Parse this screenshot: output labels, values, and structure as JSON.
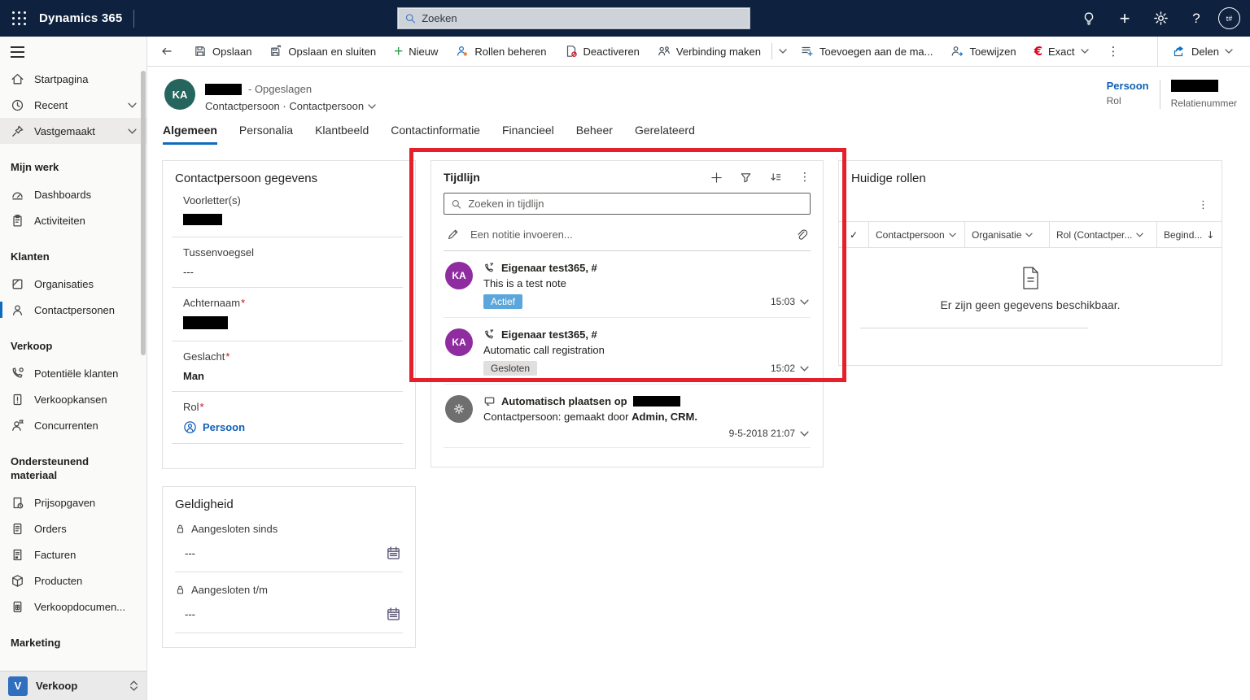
{
  "topnav": {
    "app_title": "Dynamics 365",
    "search_placeholder": "Zoeken",
    "account_initials": "t#"
  },
  "command_bar": {
    "items": [
      {
        "label": "Opslaan",
        "icon": "save-icon"
      },
      {
        "label": "Opslaan en sluiten",
        "icon": "save-close-icon"
      },
      {
        "label": "Nieuw",
        "icon": "plus-icon"
      },
      {
        "label": "Rollen beheren",
        "icon": "manage-roles-icon"
      },
      {
        "label": "Deactiveren",
        "icon": "deactivate-icon"
      },
      {
        "label": "Verbinding maken",
        "icon": "connect-icon"
      },
      {
        "label": "Toevoegen aan de ma...",
        "icon": "add-to-list-icon"
      },
      {
        "label": "Toewijzen",
        "icon": "assign-icon"
      },
      {
        "label": "Exact",
        "icon": "exact-logo"
      }
    ],
    "share_label": "Delen"
  },
  "sidebar": {
    "top_items": [
      {
        "label": "Startpagina",
        "icon": "home-icon"
      },
      {
        "label": "Recent",
        "icon": "clock-icon"
      },
      {
        "label": "Vastgemaakt",
        "icon": "pin-icon"
      }
    ],
    "sections": [
      {
        "header": "Mijn werk",
        "items": [
          {
            "label": "Dashboards"
          },
          {
            "label": "Activiteiten"
          }
        ]
      },
      {
        "header": "Klanten",
        "items": [
          {
            "label": "Organisaties"
          },
          {
            "label": "Contactpersonen"
          }
        ]
      },
      {
        "header": "Verkoop",
        "items": [
          {
            "label": "Potentiële klanten"
          },
          {
            "label": "Verkoopkansen"
          },
          {
            "label": "Concurrenten"
          }
        ]
      },
      {
        "header": "Ondersteunend materiaal",
        "items": [
          {
            "label": "Prijsopgaven"
          },
          {
            "label": "Orders"
          },
          {
            "label": "Facturen"
          },
          {
            "label": "Producten"
          },
          {
            "label": "Verkoopdocumen..."
          }
        ]
      },
      {
        "header": "Marketing",
        "items": []
      }
    ],
    "area_switcher": {
      "initial": "V",
      "label": "Verkoop"
    }
  },
  "record": {
    "avatar_initials": "KA",
    "saved_suffix": "- Opgeslagen",
    "subtitle": "Contactpersoon · Contactpersoon",
    "role_value": "Persoon",
    "role_label": "Rol",
    "relation_label": "Relatienummer"
  },
  "tabs": [
    {
      "label": "Algemeen",
      "active": true
    },
    {
      "label": "Personalia"
    },
    {
      "label": "Klantbeeld"
    },
    {
      "label": "Contactinformatie"
    },
    {
      "label": "Financieel"
    },
    {
      "label": "Beheer"
    },
    {
      "label": "Gerelateerd"
    }
  ],
  "contact_details": {
    "title": "Contactpersoon gegevens",
    "fields": [
      {
        "label": "Voorletter(s)",
        "redacted": true
      },
      {
        "label": "Tussenvoegsel",
        "value": "---"
      },
      {
        "label": "Achternaam",
        "required": "*",
        "redacted": true
      },
      {
        "label": "Geslacht",
        "required": "*",
        "value": "Man"
      },
      {
        "label": "Rol",
        "required": "*",
        "value": "Persoon"
      }
    ]
  },
  "validity": {
    "title": "Geldigheid",
    "fields": [
      {
        "label": "Aangesloten sinds",
        "value": "---"
      },
      {
        "label": "Aangesloten t/m",
        "value": "---"
      }
    ]
  },
  "timeline": {
    "title": "Tijdlijn",
    "search_placeholder": "Zoeken in tijdlijn",
    "note_placeholder": "Een notitie invoeren...",
    "entries": [
      {
        "initials": "KA",
        "title": "Eigenaar test365, #",
        "body": "This is a test note",
        "status": "Actief",
        "time": "15:03"
      },
      {
        "initials": "KA",
        "title": "Eigenaar test365, #",
        "body": "Automatic call registration",
        "status": "Gesloten",
        "time": "15:02"
      },
      {
        "title": "Automatisch plaatsen op",
        "body_prefix": "Contactpersoon: gemaakt door ",
        "body_bold": "Admin, CRM.",
        "time": "9-5-2018 21:07",
        "system": true
      }
    ]
  },
  "current_roles": {
    "title": "Huidige rollen",
    "columns": [
      {
        "label": "Contactpersoon"
      },
      {
        "label": "Organisatie"
      },
      {
        "label": "Rol (Contactper..."
      },
      {
        "label": "Begind..."
      }
    ],
    "empty_text": "Er zijn geen gegevens beschikbaar."
  },
  "colors": {
    "nav_bar": "#0e2240",
    "accent_blue": "#0f6cbd",
    "link_blue": "#1160b7",
    "highlight_red": "#e5202a",
    "badge_active_bg": "#5ba7dc",
    "badge_closed_bg": "#e1dfdd",
    "avatar_purple": "#8e2ca0",
    "avatar_teal": "#25655d",
    "exact_red": "#e2001a"
  }
}
